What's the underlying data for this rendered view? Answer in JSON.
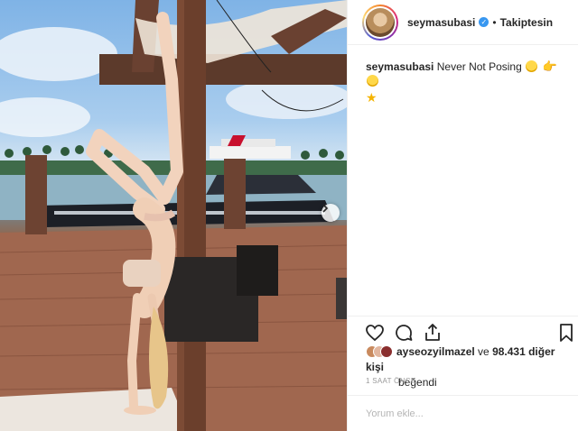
{
  "post": {
    "username": "seymasubasi",
    "follow_status": "Takiptesin",
    "caption_text": "Never Not Posing",
    "likes": {
      "first_liker": "ayseozyilmazel",
      "connector": " ve ",
      "others_count": "98.431 diğer kişi",
      "suffix": "beğendi"
    },
    "timestamp": "1 SAAT ÖNCE",
    "comment_placeholder": "Yorum ekle..."
  },
  "icons": {
    "verified": "verified-badge-icon",
    "like": "heart-icon",
    "comment": "comment-bubble-icon",
    "share": "share-icon",
    "save": "bookmark-icon",
    "next": "chevron-right-icon"
  },
  "colors": {
    "verified_blue": "#3897f0",
    "text": "#262626",
    "muted": "#999999",
    "border": "#efefef"
  }
}
